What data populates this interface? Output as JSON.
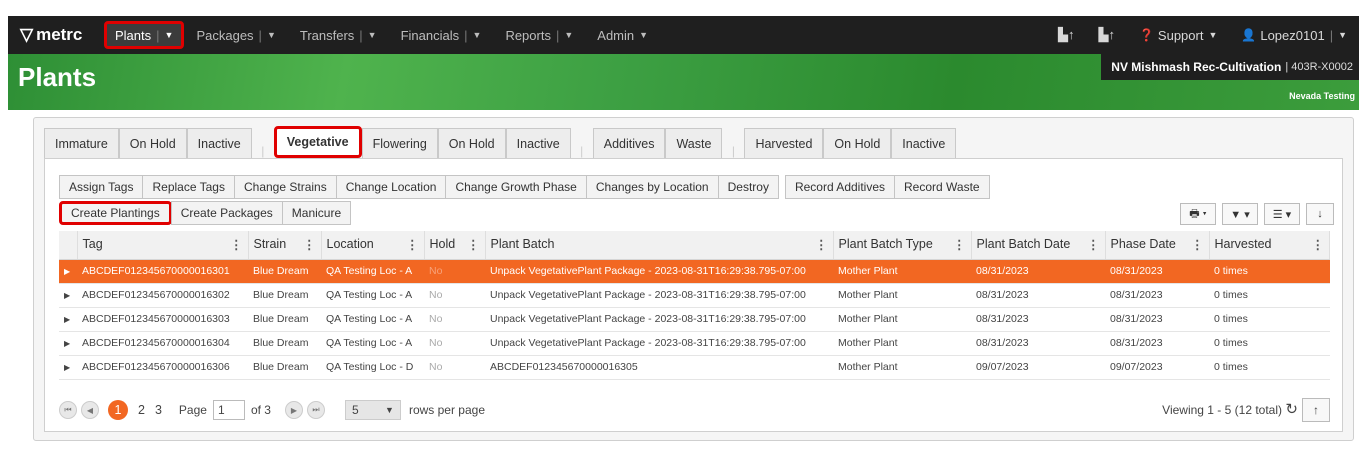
{
  "app": {
    "logo": "metrc",
    "logo_icon": "metrc-mark-icon"
  },
  "nav": [
    {
      "label": "Plants",
      "active": true
    },
    {
      "label": "Packages"
    },
    {
      "label": "Transfers"
    },
    {
      "label": "Financials"
    },
    {
      "label": "Reports"
    },
    {
      "label": "Admin"
    }
  ],
  "nav_right": {
    "support": "Support",
    "user": "Lopez0101"
  },
  "page": {
    "title": "Plants"
  },
  "facility": {
    "name": "NV Mishmash Rec-Cultivation",
    "license": "| 403R-X0002",
    "env": "Nevada Testing"
  },
  "tabs": [
    "Immature",
    "On Hold",
    "Inactive",
    "Vegetative",
    "Flowering",
    "On Hold",
    "Inactive",
    "Additives",
    "Waste",
    "Harvested",
    "On Hold",
    "Inactive"
  ],
  "toolbar": {
    "row1": [
      "Assign Tags",
      "Replace Tags",
      "Change Strains",
      "Change Location",
      "Change Growth Phase",
      "Changes by Location",
      "Destroy"
    ],
    "row1b": [
      "Record Additives",
      "Record Waste"
    ],
    "row2": [
      "Create Plantings",
      "Create Packages",
      "Manicure"
    ]
  },
  "columns": [
    "Tag",
    "Strain",
    "Location",
    "Hold",
    "Plant Batch",
    "Plant Batch Type",
    "Plant Batch Date",
    "Phase Date",
    "Harvested"
  ],
  "rows": [
    [
      "ABCDEF012345670000016301",
      "Blue Dream",
      "QA Testing Loc - A",
      "No",
      "Unpack VegetativePlant Package - 2023-08-31T16:29:38.795-07:00",
      "Mother Plant",
      "08/31/2023",
      "08/31/2023",
      "0 times"
    ],
    [
      "ABCDEF012345670000016302",
      "Blue Dream",
      "QA Testing Loc - A",
      "No",
      "Unpack VegetativePlant Package - 2023-08-31T16:29:38.795-07:00",
      "Mother Plant",
      "08/31/2023",
      "08/31/2023",
      "0 times"
    ],
    [
      "ABCDEF012345670000016303",
      "Blue Dream",
      "QA Testing Loc - A",
      "No",
      "Unpack VegetativePlant Package - 2023-08-31T16:29:38.795-07:00",
      "Mother Plant",
      "08/31/2023",
      "08/31/2023",
      "0 times"
    ],
    [
      "ABCDEF012345670000016304",
      "Blue Dream",
      "QA Testing Loc - A",
      "No",
      "Unpack VegetativePlant Package - 2023-08-31T16:29:38.795-07:00",
      "Mother Plant",
      "08/31/2023",
      "08/31/2023",
      "0 times"
    ],
    [
      "ABCDEF012345670000016306",
      "Blue Dream",
      "QA Testing Loc - D",
      "No",
      "ABCDEF012345670000016305",
      "Mother Plant",
      "09/07/2023",
      "09/07/2023",
      "0 times"
    ]
  ],
  "pager": {
    "pages": [
      "1",
      "2",
      "3"
    ],
    "page_label": "Page",
    "page_value": "1",
    "of_label": "of 3",
    "rows_per_page": "5",
    "rows_label": "rows per page",
    "viewing": "Viewing 1 - 5 (12 total)"
  },
  "colors": {
    "accent": "#f26722",
    "highlight": "#e00000",
    "nav_bg": "#1f1f1f"
  }
}
